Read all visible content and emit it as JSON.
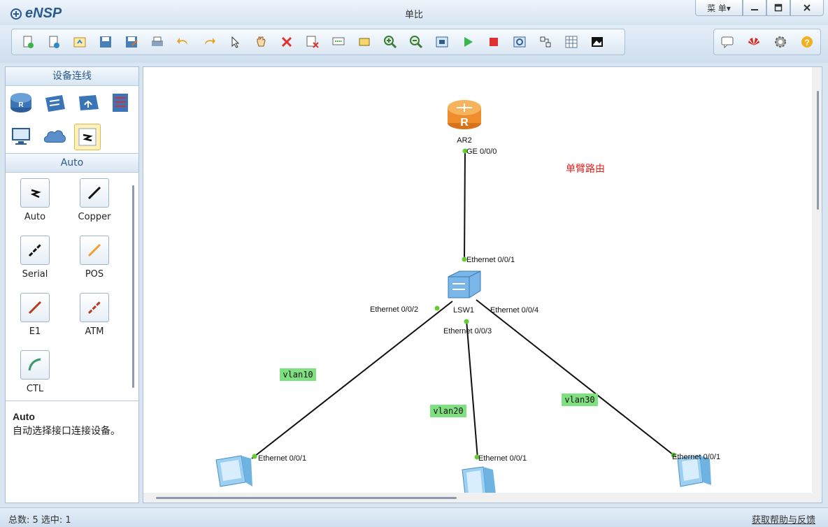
{
  "app": {
    "name": "eNSP",
    "window_title": "单比",
    "menu_label": "菜 单▾"
  },
  "toolbar": {
    "left_icons": [
      "new-topology-icon",
      "new-exercise-icon",
      "open-icon",
      "save-icon",
      "save-as-icon",
      "print-icon",
      "undo-icon",
      "redo-icon",
      "select-icon",
      "pan-icon",
      "delete-icon",
      "delete-all-links-icon",
      "text-icon",
      "rectangle-icon",
      "zoom-in-icon",
      "zoom-out-icon",
      "fit-window-icon",
      "start-device-icon",
      "stop-device-icon",
      "capture-data-icon",
      "show-interfaces-icon",
      "grid-icon",
      "topology-snapshot-icon"
    ],
    "right_icons": [
      "message-icon",
      "huawei-icon",
      "settings-icon",
      "help-icon"
    ]
  },
  "left_panel": {
    "header": "设备连线",
    "device_icons": [
      "router-icon",
      "switch-icon",
      "wlan-icon",
      "firewall-icon",
      "pc-icon",
      "cloud-icon",
      "connection-icon"
    ],
    "sub_header": "Auto",
    "cables": [
      {
        "label": "Auto",
        "icon": "auto-cable-icon"
      },
      {
        "label": "Copper",
        "icon": "copper-cable-icon"
      },
      {
        "label": "Serial",
        "icon": "serial-cable-icon"
      },
      {
        "label": "POS",
        "icon": "pos-cable-icon"
      },
      {
        "label": "E1",
        "icon": "e1-cable-icon"
      },
      {
        "label": "ATM",
        "icon": "atm-cable-icon"
      },
      {
        "label": "CTL",
        "icon": "ctl-cable-icon"
      }
    ],
    "description": {
      "title": "Auto",
      "text": "自动选择接口连接设备。"
    }
  },
  "topology": {
    "note": "单臂路由",
    "devices": {
      "router": "AR2",
      "switch": "LSW1"
    },
    "interfaces": {
      "router_ge": "GE 0/0/0",
      "sw_e1": "Ethernet 0/0/1",
      "sw_e2": "Ethernet 0/0/2",
      "sw_e3": "Ethernet 0/0/3",
      "sw_e4": "Ethernet 0/0/4",
      "pc1_e1": "Ethernet 0/0/1",
      "pc2_e1": "Ethernet 0/0/1",
      "pc3_e1": "Ethernet 0/0/1"
    },
    "vlans": [
      "vlan10",
      "vlan20",
      "vlan30"
    ],
    "colors": {
      "vlan_bg": "#7ee07e",
      "note": "#e02020",
      "port_dot": "#66cc33"
    }
  },
  "status": {
    "left": "总数: 5 选中: 1",
    "right": "获取帮助与反馈"
  }
}
